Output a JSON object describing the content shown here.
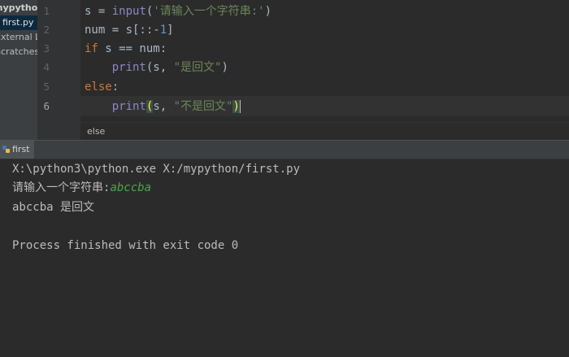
{
  "sidebar": {
    "root": "mypython",
    "file": "first.py",
    "external": "External Libraries",
    "scratches": "Scratches and Consoles"
  },
  "gutter": {
    "lines": [
      "1",
      "2",
      "3",
      "4",
      "5",
      "6"
    ]
  },
  "code": {
    "l1_var": "s",
    "l1_eq": " = ",
    "l1_func": "input",
    "l1_open": "(",
    "l1_str": "'请输入一个字符串:'",
    "l1_close": ")",
    "l2_a": "num = s[::-",
    "l2_num": "1",
    "l2_b": "]",
    "l3_kw": "if",
    "l3_rest": " s == num:",
    "l4_indent": "    ",
    "l4_func": "print",
    "l4_a": "(s, ",
    "l4_str": "\"是回文\"",
    "l4_b": ")",
    "l5_kw": "else",
    "l5_colon": ":",
    "l6_indent": "    ",
    "l6_func": "print",
    "l6_open": "(",
    "l6_a": "s, ",
    "l6_str": "\"不是回文\"",
    "l6_close": ")"
  },
  "breadcrumb": {
    "text": "else"
  },
  "run": {
    "tab_label": "first",
    "icon": "python-run-icon",
    "console": {
      "cmd": "X:\\python3\\python.exe X:/mypython/first.py",
      "prompt": "请输入一个字符串:",
      "input": "abccba",
      "result": "abccba 是回文",
      "exit": "Process finished with exit code 0"
    }
  },
  "colors": {
    "keyword": "#cc7832",
    "string": "#6a8759",
    "number": "#6897bb",
    "builtin": "#8888c6",
    "console_input": "#4aa548"
  }
}
